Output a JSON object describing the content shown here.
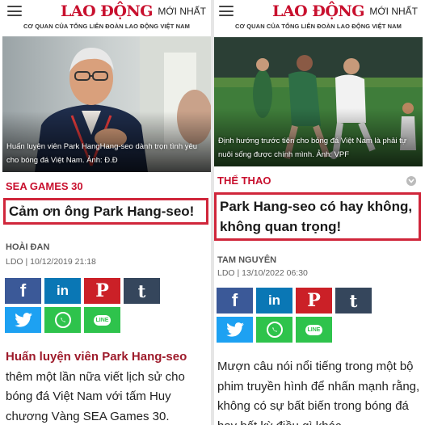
{
  "left": {
    "logo": "LAO ĐỘNG",
    "nav_newest": "MỚI NHẤT",
    "tagline": "CƠ QUAN CỦA TỔNG LIÊN ĐOÀN LAO ĐỘNG VIỆT NAM",
    "photo_caption": "Huấn luyện viên Park HangHang-seo dành trọn tình yêu cho bóng đá Việt Nam. Ảnh: Đ.Đ",
    "section": "SEA GAMES 30",
    "headline": "Cảm ơn ông Park Hang-seo!",
    "author": "HOÀI ĐAN",
    "dateline": "LDO | 10/12/2019 21:18",
    "body_lead": "Huấn luyện viên Park Hang-seo",
    "body_rest": " thêm một lần nữa viết lịch sử cho bóng đá Việt Nam với tấm Huy chương Vàng SEA Games 30."
  },
  "right": {
    "logo": "LAO ĐỘNG",
    "nav_newest": "MỚI NHẤT",
    "tagline": "CƠ QUAN CỦA TỔNG LIÊN ĐOÀN LAO ĐỘNG VIỆT NAM",
    "photo_caption": "Định hướng trước tiên cho bóng đá Việt Nam là phải tự nuôi sống được chính mình. Ảnh: VPF",
    "section": "THỂ THAO",
    "headline": "Park Hang-seo có hay không, không quan trọng!",
    "author": "TAM NGUYÊN",
    "dateline": "LDO | 13/10/2022 06:30",
    "body": "Mượn câu nói nổi tiếng trong một bộ phim truyền hình để nhấn mạnh rằng, không có sự bất biến trong bóng đá hay bất kỳ điều gì khác..."
  },
  "share": {
    "facebook": "f",
    "linkedin": "in",
    "pinterest": "P",
    "tumblr": "t",
    "line": "LINE"
  },
  "colors": {
    "brand_red": "#c8102e",
    "highlight_box": "#d0263b",
    "facebook": "#3b5998",
    "linkedin": "#0a77b5",
    "pinterest": "#cb2027",
    "tumblr": "#35465c",
    "twitter": "#1da1f2",
    "whatsapp": "#2ec34c",
    "line": "#2ec34c"
  },
  "icons": [
    "hamburger-menu-icon",
    "facebook-icon",
    "linkedin-icon",
    "pinterest-icon",
    "tumblr-icon",
    "twitter-icon",
    "whatsapp-icon",
    "line-icon",
    "chevron-down-icon"
  ]
}
